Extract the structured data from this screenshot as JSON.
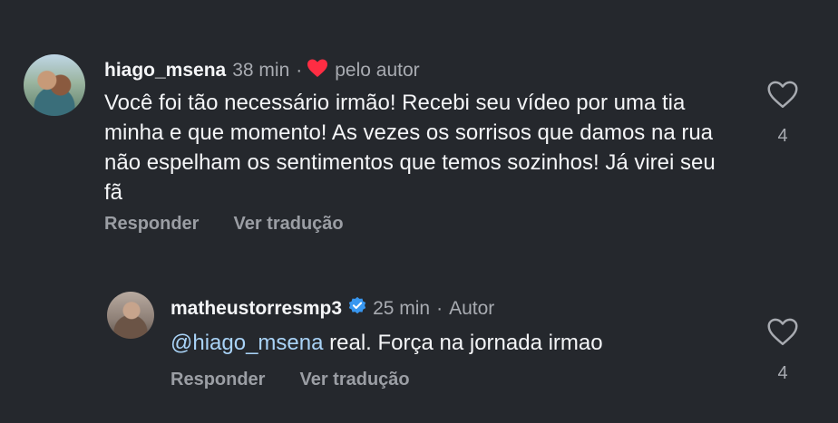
{
  "comment1": {
    "username": "hiago_msena",
    "time": "38 min",
    "separator": "·",
    "liked_by_author": "pelo autor",
    "text": "Você foi tão necessário irmão! Recebi seu vídeo por uma tia minha e que momento! As vezes os sorrisos que damos na rua não espelham os sentimentos que temos sozinhos! Já virei seu fã",
    "reply_label": "Responder",
    "translate_label": "Ver tradução",
    "like_count": "4"
  },
  "comment2": {
    "username": "matheustorresmp3",
    "time": "25 min",
    "separator": "·",
    "author_label": "Autor",
    "mention": "@hiago_msena",
    "text": " real. Força na jornada irmao",
    "reply_label": "Responder",
    "translate_label": "Ver tradução",
    "like_count": "4"
  },
  "colors": {
    "background": "#25282d",
    "heart_red": "#ff2d43",
    "verified_blue": "#3897f0",
    "mention_blue": "#a9d3f7"
  },
  "icons": {
    "author_heart": "heart-filled-icon",
    "verified": "verified-badge-icon",
    "like": "heart-outline-icon"
  }
}
